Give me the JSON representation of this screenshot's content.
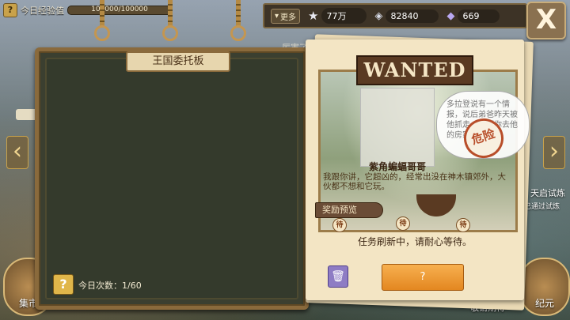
{
  "exp": {
    "label": "今日经验值",
    "value": "100000/100000"
  },
  "topbar": {
    "more_label": "更多",
    "stars": "77万",
    "shells": "82840",
    "gems": "669"
  },
  "close_label": "X",
  "ticker": "厉害了，竟然挑战成功了10个",
  "board": {
    "title": "王国委托板",
    "help_label": "?",
    "count_label": "今日次数：1/60"
  },
  "poster": {
    "wanted": "WANTED",
    "bubble_text": "多拉登说有一个情报，说后弟爸昨天被他抓走，需要你去他的房家里去。",
    "danger": "危险",
    "monster_name": "紫角蝙蝠哥哥",
    "description": "我跟你讲，它超凶的，经常出没在神木镇郊外，大伙都不想和它玩。",
    "reward_label": "奖励预览",
    "badge": "待",
    "refresh_text": "任务刷新中，请耐心等待。",
    "go_label": "?"
  },
  "side": {
    "right_title": "天启试炼",
    "right_sub": "已通过试炼",
    "bottom_left": "集市",
    "bottom_right": "纪元",
    "bottom_stay": "敬请期待"
  }
}
